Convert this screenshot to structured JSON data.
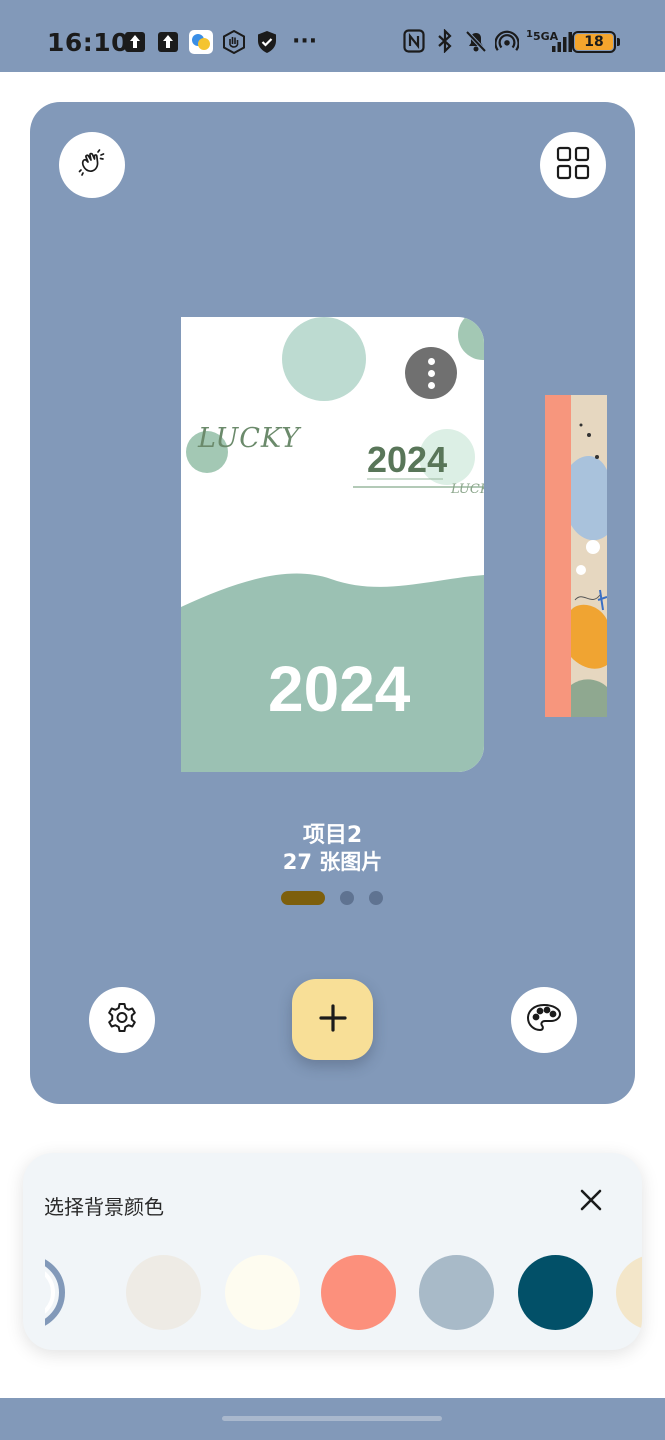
{
  "status_bar": {
    "time": "16:10",
    "left_icons": [
      "upload-icon",
      "upload-icon",
      "app-icon",
      "hand-icon",
      "shield-icon"
    ],
    "more": "···",
    "right_icons": [
      "nfc-icon",
      "bluetooth-icon",
      "bell-off-icon",
      "hotspot-icon",
      "signal-icon"
    ],
    "network": "5GA",
    "sim_index": "1",
    "battery": "18"
  },
  "card": {
    "background": "#8299b9",
    "top_left_icon": "hand-wave-icon",
    "top_right_icon": "grid-icon",
    "book": {
      "lucky_text": "LUCKY",
      "year_small": "2024",
      "lucky_small": "LUCKY",
      "year_big": "2024"
    },
    "project": {
      "name": "项目2",
      "count": "27 张图片"
    },
    "pager": {
      "pages": 3,
      "current": 1
    },
    "settings_icon": "gear-icon",
    "add_icon": "plus-icon",
    "palette_icon": "palette-icon"
  },
  "sheet": {
    "title": "选择背景颜色",
    "close_icon": "close-icon",
    "selected_color": "#8299b9",
    "colors": [
      "#eeebe5",
      "#fefcf0",
      "#fc907c",
      "#a8bac8",
      "#025068"
    ],
    "partial_color": "#f3e6c9"
  }
}
